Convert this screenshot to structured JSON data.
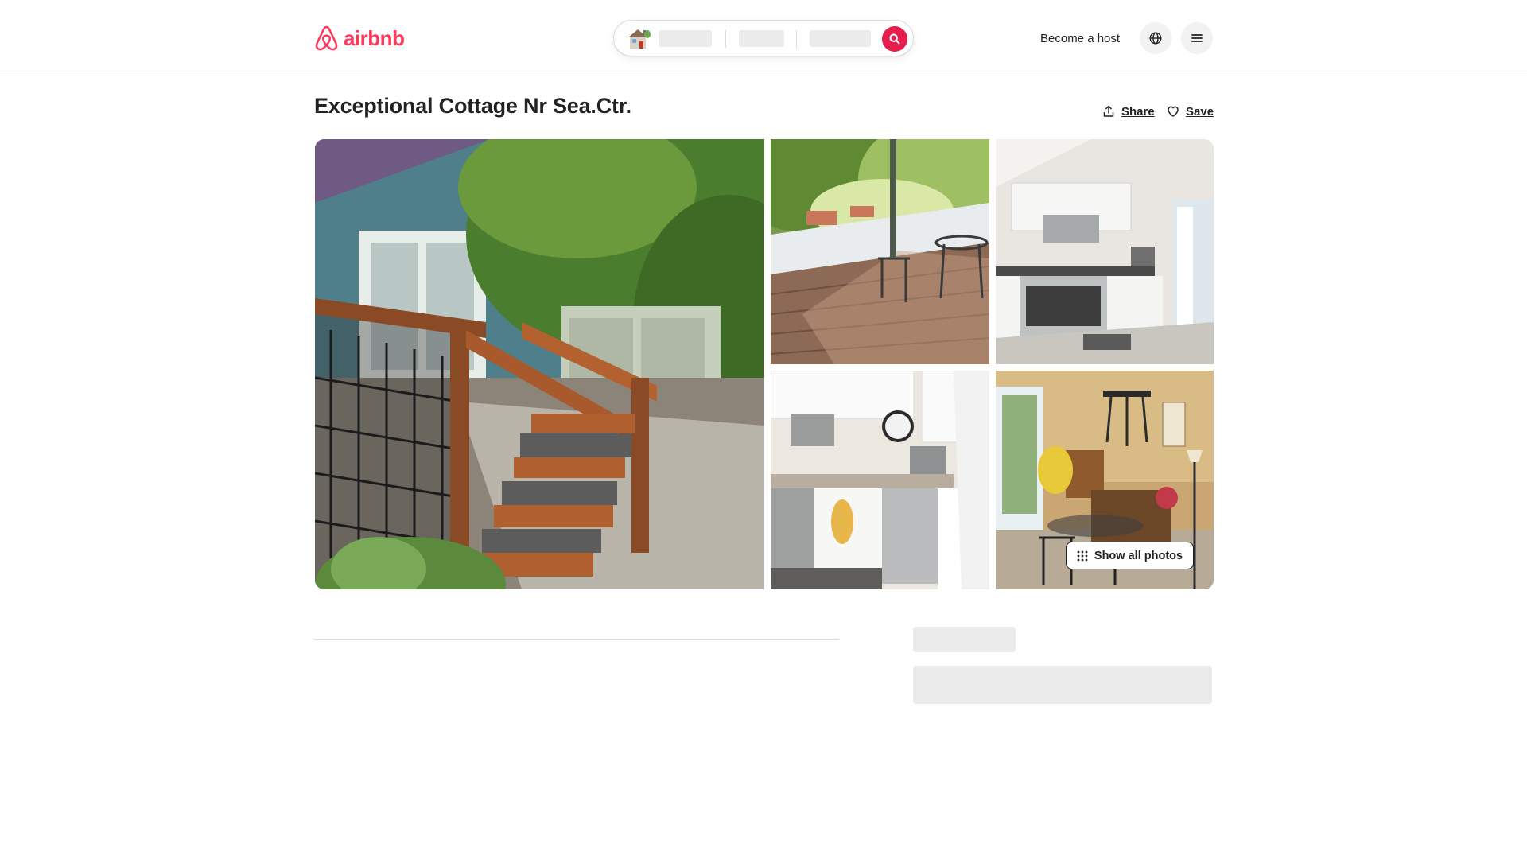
{
  "brand": {
    "name": "airbnb",
    "color": "#ff385c"
  },
  "search": {
    "icon": "house-icon",
    "button_icon": "search-icon",
    "button_color": "#e61e4d"
  },
  "header": {
    "become_host": "Become a host",
    "language_icon": "globe-icon",
    "menu_icon": "hamburger-menu-icon"
  },
  "listing": {
    "title": "Exceptional Cottage Nr Sea.Ctr.",
    "share_label": "Share",
    "save_label": "Save"
  },
  "gallery": {
    "show_all_label": "Show all photos",
    "photos": [
      {
        "subject": "wooden stairs and railing beside a blue cottage"
      },
      {
        "subject": "sunny wooden deck with patio chairs"
      },
      {
        "subject": "white kitchen with stainless appliances"
      },
      {
        "subject": "kitchen counter with sink, clock and dishwasher"
      },
      {
        "subject": "dining nook with open French doors"
      }
    ]
  },
  "colors": {
    "skeleton": "#ebebeb",
    "text": "#222222",
    "divider": "#dddddd"
  }
}
